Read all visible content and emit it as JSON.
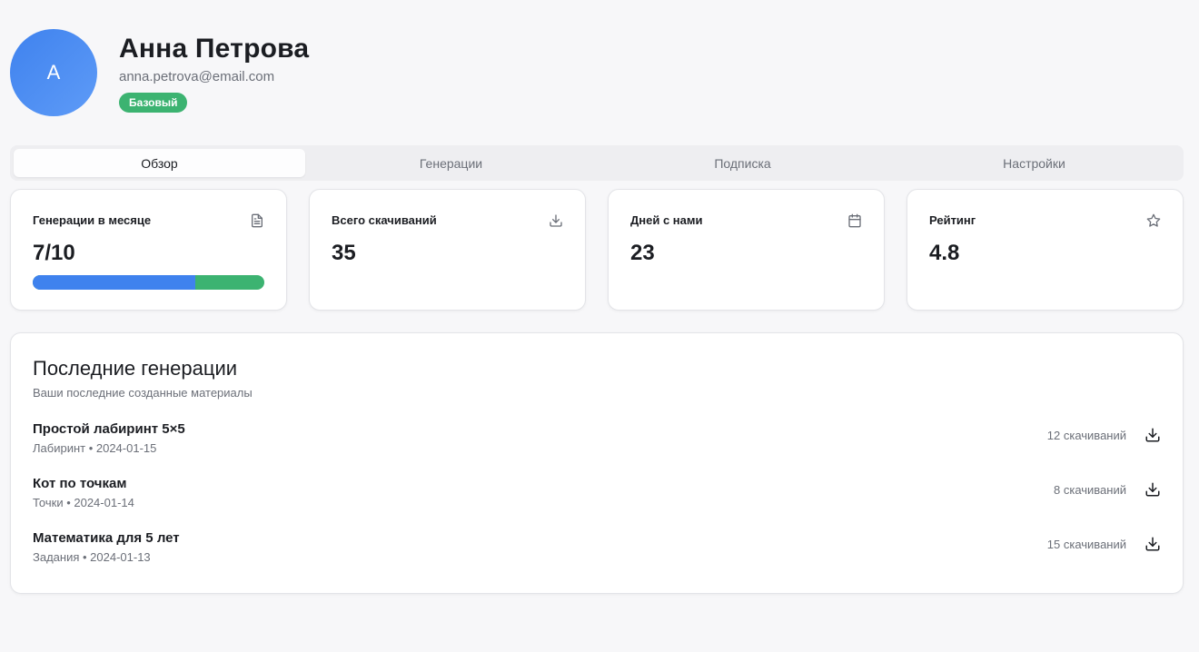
{
  "user": {
    "avatar_letter": "А",
    "name": "Анна Петрова",
    "email": "anna.petrova@email.com",
    "plan_badge": "Базовый"
  },
  "tabs": [
    {
      "label": "Обзор",
      "active": true
    },
    {
      "label": "Генерации",
      "active": false
    },
    {
      "label": "Подписка",
      "active": false
    },
    {
      "label": "Настройки",
      "active": false
    }
  ],
  "stats": [
    {
      "label": "Генерации в месяце",
      "value": "7/10",
      "icon": "document-icon",
      "progress": 0.7
    },
    {
      "label": "Всего скачиваний",
      "value": "35",
      "icon": "download-icon"
    },
    {
      "label": "Дней с нами",
      "value": "23",
      "icon": "calendar-icon"
    },
    {
      "label": "Рейтинг",
      "value": "4.8",
      "icon": "star-icon"
    }
  ],
  "recent": {
    "title": "Последние генерации",
    "subtitle": "Ваши последние созданные материалы",
    "items": [
      {
        "title": "Простой лабиринт 5×5",
        "meta": "Лабиринт • 2024-01-15",
        "downloads": "12 скачиваний"
      },
      {
        "title": "Кот по точкам",
        "meta": "Точки • 2024-01-14",
        "downloads": "8 скачиваний"
      },
      {
        "title": "Математика для 5 лет",
        "meta": "Задания • 2024-01-13",
        "downloads": "15 скачиваний"
      }
    ]
  },
  "colors": {
    "accent_blue": "#3f82ee",
    "accent_green": "#3cb371"
  }
}
